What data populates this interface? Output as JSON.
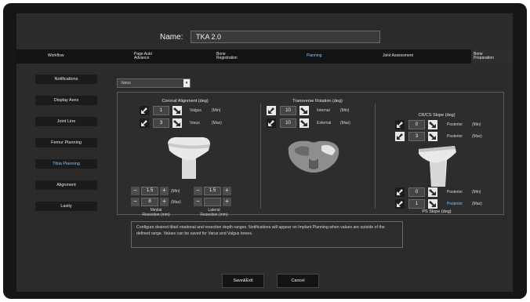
{
  "header": {
    "name_label": "Name:",
    "name_value": "TKA 2.0"
  },
  "steps": [
    {
      "label": "Workflow"
    },
    {
      "label": "Page Auto\nAdvance"
    },
    {
      "label": "Bone\nRegistration"
    },
    {
      "label": "Planning"
    },
    {
      "label": "Joint Assessment"
    },
    {
      "label": "Bone\nPreparation"
    }
  ],
  "active_step": "Planning",
  "sidebar": [
    {
      "label": "Notifications"
    },
    {
      "label": "Display Axes"
    },
    {
      "label": "Joint Line"
    },
    {
      "label": "Femur Planning"
    },
    {
      "label": "Tibia Planning"
    },
    {
      "label": "Alignment"
    },
    {
      "label": "Laxity"
    }
  ],
  "active_sidebar": "Tibia Planning",
  "dropdown": {
    "value": "Varus"
  },
  "coronal": {
    "title": "Coronal Alignment (deg)",
    "rows": [
      {
        "value": "1",
        "direction": "Valgus",
        "limit": "(Min)"
      },
      {
        "value": "3",
        "direction": "Varus",
        "limit": "(Max)"
      }
    ]
  },
  "resection": {
    "medial": {
      "min": "1.5",
      "max": "8",
      "caption": "Medial\nResection (mm)"
    },
    "lateral": {
      "min": "1.5",
      "max": "",
      "caption": "Lateral\nResection (mm)"
    },
    "min_label": "(Min)",
    "max_label": "(Max)"
  },
  "transverse": {
    "title": "Transverse Rotation (deg)",
    "rows": [
      {
        "value": "10",
        "direction": "Internal",
        "limit": "(Min)"
      },
      {
        "value": "10",
        "direction": "External",
        "limit": "(Max)"
      }
    ]
  },
  "cr_slope": {
    "title": "CR/CS Slope (deg)",
    "rows": [
      {
        "value": "0",
        "direction": "Posterior",
        "limit": "(Min)"
      },
      {
        "value": "3",
        "direction": "Posterior",
        "limit": "(Max)"
      }
    ]
  },
  "ps_slope": {
    "title": "PS Slope (deg)",
    "rows": [
      {
        "value": "0",
        "direction": "Posterior",
        "limit": "(Min)"
      },
      {
        "value": "1",
        "direction": "Posterior",
        "limit": "(Max)"
      }
    ]
  },
  "info_text": "Configure desired tibial rotational and resection depth ranges. Notifications will appear on Implant Planning when values are outside of the defined range. Values can be saved for Varus and Valgus knees.",
  "buttons": {
    "save": "Save&Exit",
    "cancel": "Cancel"
  },
  "colors": {
    "accent": "#7cc4ff",
    "background": "#2b2b2b",
    "bezel": "#161616"
  }
}
